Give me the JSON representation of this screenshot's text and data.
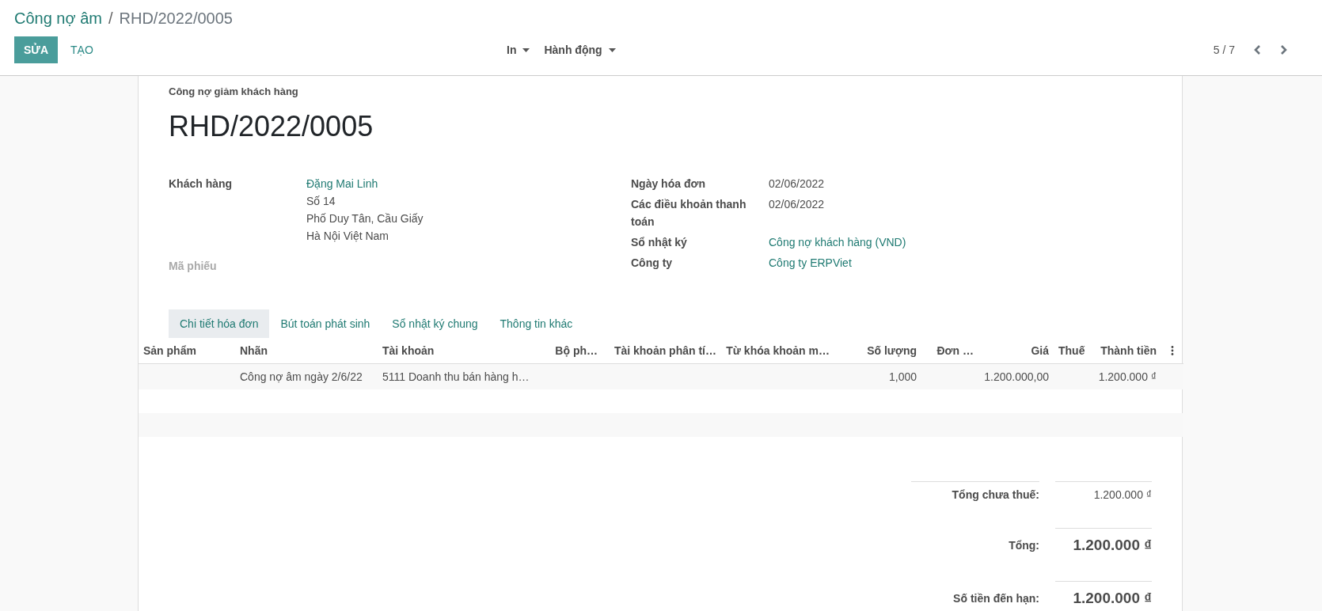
{
  "breadcrumb": {
    "parent": "Công nợ âm",
    "separator": "/",
    "current": "RHD/2022/0005"
  },
  "buttons": {
    "edit": "SỬA",
    "create": "TẠO"
  },
  "menus": [
    "In",
    "Hành động"
  ],
  "pager": {
    "counter": "5 / 7"
  },
  "form": {
    "subtitle": "Công nợ giảm khách hàng",
    "title": "RHD/2022/0005",
    "customer": {
      "label": "Khách hàng",
      "name": "Đặng Mai Linh",
      "address": [
        "Số 14",
        "Phố Duy Tân, Cầu Giấy",
        "Hà Nội Việt Nam"
      ]
    },
    "reference": {
      "label": "Mã phiếu",
      "disabled": true
    },
    "right_fields": [
      {
        "label": "Ngày hóa đơn",
        "value": "02/06/2022",
        "kind": "text"
      },
      {
        "label": "Các điều khoản thanh toán",
        "value": "02/06/2022",
        "kind": "text"
      },
      {
        "label": "Sổ nhật ký",
        "value": "Công nợ khách hàng (VND)",
        "kind": "link"
      },
      {
        "label": "Công ty",
        "value": "Công ty ERPViet",
        "kind": "link"
      }
    ]
  },
  "tabs": [
    {
      "label": "Chi tiết hóa đơn",
      "selected": true
    },
    {
      "label": "Bút toán phát sinh",
      "selected": false
    },
    {
      "label": "Sổ nhật ký chung",
      "selected": false
    },
    {
      "label": "Thông tin khác",
      "selected": false
    }
  ],
  "table": {
    "columns": [
      {
        "label": "Sản phẩm",
        "kind": "text"
      },
      {
        "label": "Nhãn",
        "kind": "text"
      },
      {
        "label": "Tài khoản",
        "kind": "text"
      },
      {
        "label": "Bộ ph…",
        "kind": "number"
      },
      {
        "label": "Tài khoản phân tí…",
        "kind": "number"
      },
      {
        "label": "Từ khóa khoản m…",
        "kind": "number"
      },
      {
        "label": "Số lượng",
        "kind": "number"
      },
      {
        "label": "Đơn …",
        "kind": "number"
      },
      {
        "label": "Giá",
        "kind": "number"
      },
      {
        "label": "Thuế",
        "kind": "number"
      },
      {
        "label": "Thành tiền",
        "kind": "number"
      }
    ],
    "rows": [
      [
        "",
        "Công nợ âm ngày 2/6/22",
        "5111 Doanh thu bán hàng h…",
        "",
        "",
        "",
        "1,000",
        "",
        "1.200.000,00",
        "",
        "1.200.000 ₫"
      ]
    ]
  },
  "totals": [
    {
      "label": "Tổng chưa thuế:",
      "value": "1.200.000 ₫",
      "kind": "subtotal"
    },
    {
      "label": "Tổng:",
      "value": "1.200.000 ₫",
      "kind": "total"
    },
    {
      "label": "Số tiền đến hạn:",
      "value": "1.200.000 ₫",
      "kind": "total"
    }
  ]
}
